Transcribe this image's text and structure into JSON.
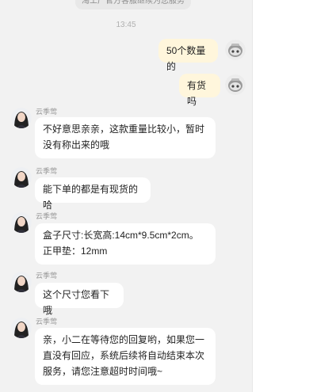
{
  "chat": {
    "system_notice": "淘工厂官方客服继续为您服务",
    "timestamp": "13:45",
    "messages": [
      {
        "from": "user",
        "text": "50个数量的"
      },
      {
        "from": "user",
        "text": "有货吗"
      },
      {
        "from": "agent",
        "sender": "云季莺",
        "text": "不好意思亲亲，这款重量比较小，暂时没有称出来的哦"
      },
      {
        "from": "agent",
        "sender": "云季莺",
        "text": "能下单的都是有现货的哈"
      },
      {
        "from": "agent",
        "sender": "云季莺",
        "text": "盒子尺寸:长宽高:14cm*9.5cm*2cm。正甲垫：12mm"
      },
      {
        "from": "agent",
        "sender": "云季莺",
        "text": "这个尺寸您看下哦"
      },
      {
        "from": "agent",
        "sender": "云季莺",
        "text": "亲，小二在等待您的回复哟，如果您一直没有回应，系统后续将自动结束本次服务，请您注意超时时间哦~"
      }
    ]
  },
  "icons": {
    "user_avatar": "robot-avatar-icon",
    "agent_avatar": "agent-avatar-icon"
  },
  "colors": {
    "chat_background": "#f2f2f2",
    "outgoing_bubble": "#fff6dc",
    "incoming_bubble": "#ffffff"
  }
}
